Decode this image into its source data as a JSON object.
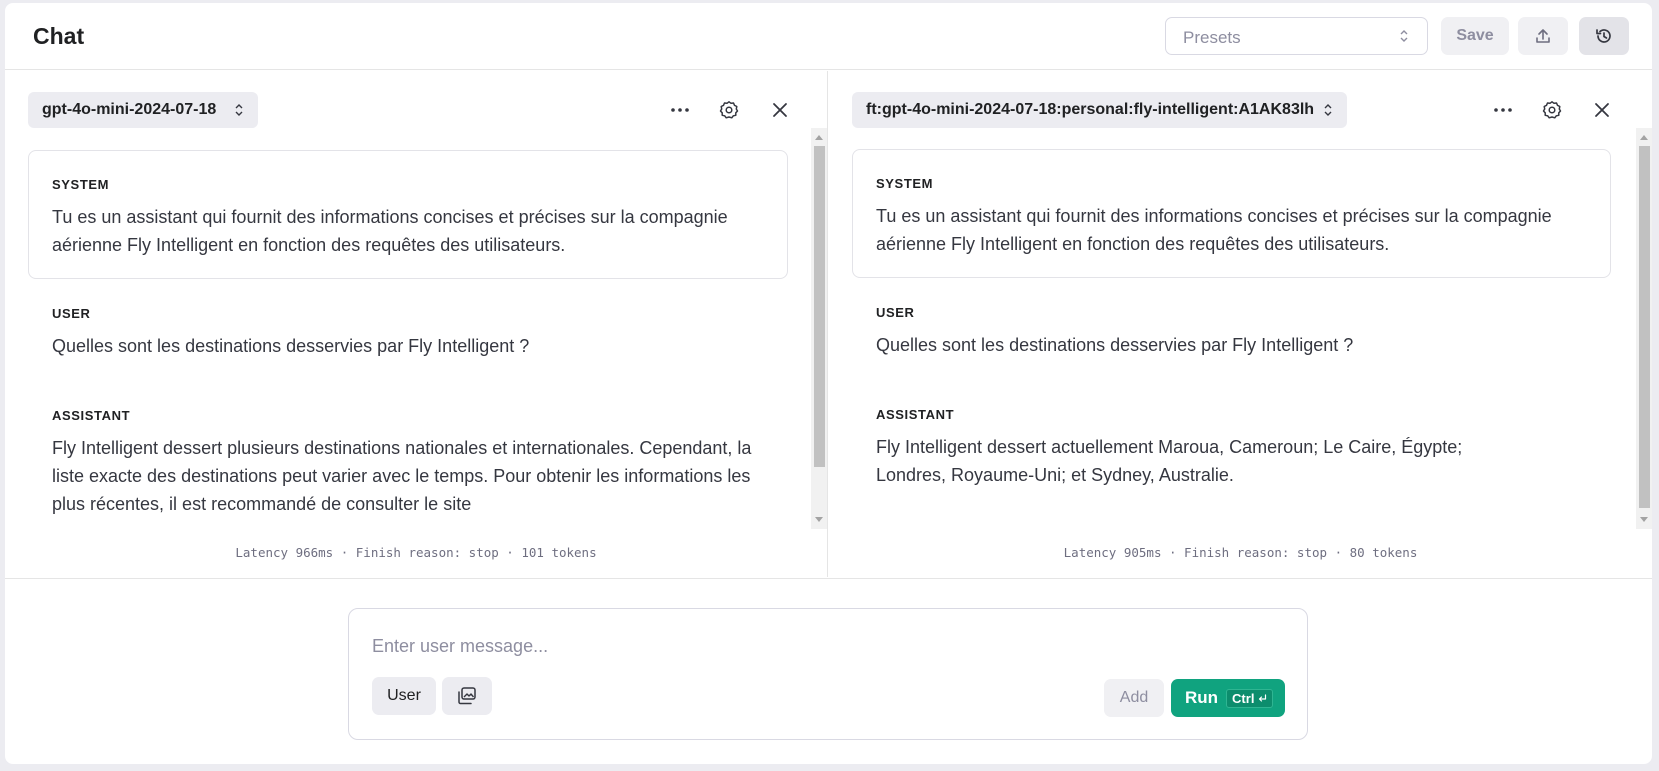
{
  "header": {
    "title": "Chat",
    "presets_placeholder": "Presets",
    "save_label": "Save"
  },
  "panels": [
    {
      "model": "gpt-4o-mini-2024-07-18",
      "messages": [
        {
          "role": "SYSTEM",
          "text": "Tu es un assistant qui fournit des informations concises et précises sur la compagnie aérienne Fly Intelligent en fonction des requêtes des utilisateurs."
        },
        {
          "role": "USER",
          "text": "Quelles sont les destinations desservies par Fly Intelligent ?"
        },
        {
          "role": "ASSISTANT",
          "text": "Fly Intelligent dessert plusieurs destinations nationales et internationales. Cependant, la liste exacte des destinations peut varier avec le temps. Pour obtenir les informations les plus récentes, il est recommandé de consulter le site"
        }
      ],
      "meta": "Latency 966ms · Finish reason: stop · 101 tokens"
    },
    {
      "model": "ft:gpt-4o-mini-2024-07-18:personal:fly-intelligent:A1AK83lh",
      "messages": [
        {
          "role": "SYSTEM",
          "text": "Tu es un assistant qui fournit des informations concises et précises sur la compagnie aérienne Fly Intelligent en fonction des requêtes des utilisateurs."
        },
        {
          "role": "USER",
          "text": "Quelles sont les destinations desservies par Fly Intelligent ?"
        },
        {
          "role": "ASSISTANT",
          "text": "Fly Intelligent dessert actuellement Maroua, Cameroun; Le Caire, Égypte; Londres, Royaume-Uni; et Sydney, Australie."
        }
      ],
      "meta": "Latency 905ms · Finish reason: stop · 80 tokens"
    }
  ],
  "composer": {
    "placeholder": "Enter user message...",
    "role_label": "User",
    "add_label": "Add",
    "run_label": "Run",
    "shortcut": "Ctrl"
  },
  "colors": {
    "accent": "#10a37f",
    "muted": "#8e8ea0"
  }
}
